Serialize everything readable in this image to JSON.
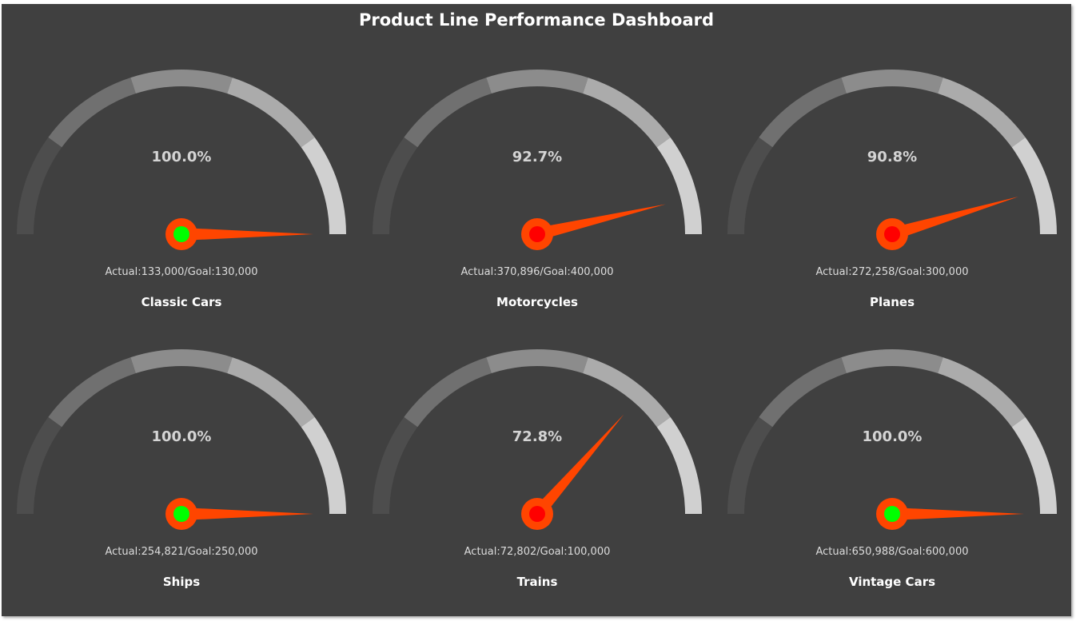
{
  "dashboard": {
    "title": "Product Line Performance Dashboard",
    "colors": {
      "background": "#404040",
      "bands": [
        "#4d4d4d",
        "#707070",
        "#8c8c8c",
        "#ababab",
        "#d0d0d0"
      ],
      "needle": "#ff4500",
      "hub_ring": "#ff4500",
      "hub_met": "#00ff00",
      "hub_not_met": "#ff0000"
    }
  },
  "chart_data": [
    {
      "type": "gauge",
      "title": "Classic Cars",
      "value_label": "100.0%",
      "value_pct": 100.0,
      "actual": 133000,
      "goal": 130000,
      "detail": "Actual:133,000/Goal:130,000",
      "goal_met": true
    },
    {
      "type": "gauge",
      "title": "Motorcycles",
      "value_label": "92.7%",
      "value_pct": 92.7,
      "actual": 370896,
      "goal": 400000,
      "detail": "Actual:370,896/Goal:400,000",
      "goal_met": false
    },
    {
      "type": "gauge",
      "title": "Planes",
      "value_label": "90.8%",
      "value_pct": 90.8,
      "actual": 272258,
      "goal": 300000,
      "detail": "Actual:272,258/Goal:300,000",
      "goal_met": false
    },
    {
      "type": "gauge",
      "title": "Ships",
      "value_label": "100.0%",
      "value_pct": 100.0,
      "actual": 254821,
      "goal": 250000,
      "detail": "Actual:254,821/Goal:250,000",
      "goal_met": true
    },
    {
      "type": "gauge",
      "title": "Trains",
      "value_label": "72.8%",
      "value_pct": 72.8,
      "actual": 72802,
      "goal": 100000,
      "detail": "Actual:72,802/Goal:100,000",
      "goal_met": false
    },
    {
      "type": "gauge",
      "title": "Vintage Cars",
      "value_label": "100.0%",
      "value_pct": 100.0,
      "actual": 650988,
      "goal": 600000,
      "detail": "Actual:650,988/Goal:600,000",
      "goal_met": true
    }
  ]
}
